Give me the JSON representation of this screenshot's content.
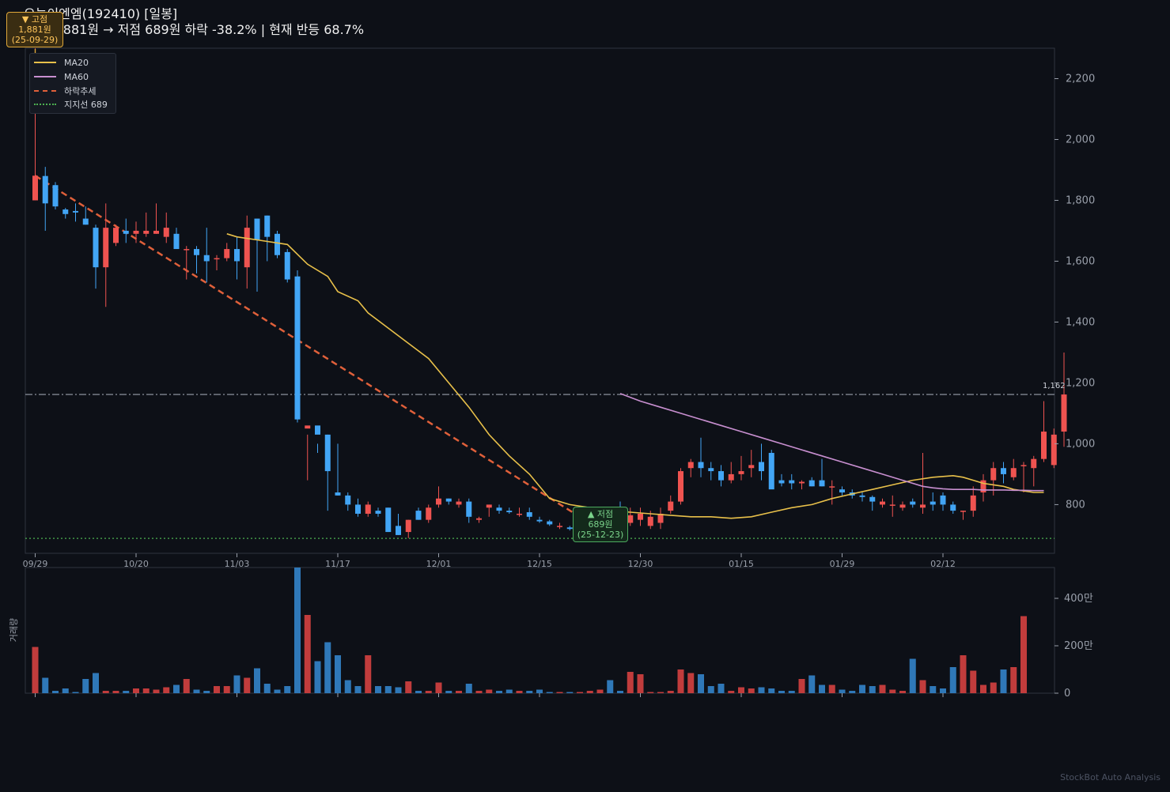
{
  "header": {
    "line1": "오늘이엔엠(192410)  [일봉]",
    "line2": "고점 1,881원 → 저점 689원  하락 -38.2%  |  현재 반등 68.7%"
  },
  "watermark": "StockBot Auto Analysis",
  "legend": {
    "items": [
      {
        "label": "MA20",
        "color": "#e8c04a",
        "style": "solid"
      },
      {
        "label": "MA60",
        "color": "#c88fd0",
        "style": "solid"
      },
      {
        "label": "하락추세",
        "color": "#e0603a",
        "style": "dashed"
      },
      {
        "label": "지지선 689",
        "color": "#4caf50",
        "style": "dotted"
      }
    ]
  },
  "callouts": {
    "high": {
      "marker": "▼ 고점",
      "price": "1,881원",
      "date": "(25-09-29)"
    },
    "low": {
      "marker": "▲ 저점",
      "price": "689원",
      "date": "(25-12-23)"
    }
  },
  "resistance_label": "1,162",
  "colors": {
    "up": "#ef5350",
    "down": "#42a5f5",
    "up_vol": "#c13c3c",
    "down_vol": "#2f78b8",
    "grid": "#222733",
    "axis": "#9aa0ab"
  },
  "chart_data": [
    {
      "type": "candlestick",
      "title": "오늘이엔엠(192410)  [일봉]",
      "x_tick_labels": [
        "09/29",
        "10/20",
        "11/03",
        "11/17",
        "12/01",
        "12/15",
        "12/30",
        "01/15",
        "01/29",
        "02/12"
      ],
      "x_tick_index": [
        0,
        10,
        20,
        30,
        40,
        50,
        60,
        70,
        80,
        90
      ],
      "y_ticks": [
        800,
        1000,
        1200,
        1400,
        1600,
        1800,
        2000,
        2200
      ],
      "y_tick_labels": [
        "800",
        "1,000",
        "1,200",
        "1,400",
        "1,600",
        "1,800",
        "2,000",
        "2,200"
      ],
      "ylim": [
        640,
        2300
      ],
      "support": 689,
      "resistance": 1162,
      "trend_line": {
        "from_index": 0,
        "from_value": 1881,
        "to_index": 54,
        "to_value": 760
      },
      "ohlc": [
        [
          1800,
          2300,
          1800,
          1881
        ],
        [
          1880,
          1910,
          1700,
          1790
        ],
        [
          1850,
          1860,
          1770,
          1780
        ],
        [
          1770,
          1775,
          1740,
          1755
        ],
        [
          1765,
          1790,
          1730,
          1760
        ],
        [
          1740,
          1780,
          1720,
          1720
        ],
        [
          1710,
          1720,
          1510,
          1580
        ],
        [
          1580,
          1790,
          1450,
          1710
        ],
        [
          1660,
          1720,
          1650,
          1710
        ],
        [
          1700,
          1740,
          1660,
          1690
        ],
        [
          1690,
          1730,
          1660,
          1700
        ],
        [
          1690,
          1760,
          1680,
          1700
        ],
        [
          1690,
          1790,
          1690,
          1700
        ],
        [
          1680,
          1760,
          1660,
          1710
        ],
        [
          1690,
          1710,
          1640,
          1640
        ],
        [
          1640,
          1650,
          1540,
          1640
        ],
        [
          1640,
          1650,
          1560,
          1620
        ],
        [
          1620,
          1710,
          1530,
          1600
        ],
        [
          1610,
          1620,
          1570,
          1610
        ],
        [
          1610,
          1660,
          1600,
          1640
        ],
        [
          1640,
          1680,
          1540,
          1600
        ],
        [
          1580,
          1750,
          1510,
          1710
        ],
        [
          1740,
          1740,
          1500,
          1670
        ],
        [
          1750,
          1750,
          1600,
          1680
        ],
        [
          1690,
          1700,
          1610,
          1620
        ],
        [
          1630,
          1640,
          1530,
          1540
        ],
        [
          1550,
          1570,
          1070,
          1080
        ],
        [
          1050,
          1030,
          880,
          1060
        ],
        [
          1060,
          1000,
          970,
          1030
        ],
        [
          1030,
          1030,
          780,
          910
        ],
        [
          840,
          1000,
          830,
          830
        ],
        [
          830,
          840,
          780,
          800
        ],
        [
          800,
          820,
          760,
          770
        ],
        [
          770,
          810,
          760,
          800
        ],
        [
          780,
          790,
          760,
          770
        ],
        [
          790,
          790,
          710,
          710
        ],
        [
          730,
          770,
          700,
          700
        ],
        [
          710,
          750,
          690,
          750
        ],
        [
          780,
          790,
          750,
          750
        ],
        [
          750,
          800,
          740,
          790
        ],
        [
          800,
          860,
          790,
          820
        ],
        [
          820,
          820,
          800,
          810
        ],
        [
          800,
          820,
          790,
          810
        ],
        [
          810,
          820,
          740,
          760
        ],
        [
          750,
          760,
          740,
          755
        ],
        [
          790,
          800,
          760,
          800
        ],
        [
          790,
          800,
          770,
          780
        ],
        [
          780,
          790,
          770,
          775
        ],
        [
          770,
          790,
          760,
          770
        ],
        [
          775,
          790,
          750,
          760
        ],
        [
          750,
          760,
          740,
          745
        ],
        [
          745,
          750,
          730,
          735
        ],
        [
          730,
          740,
          720,
          730
        ],
        [
          725,
          730,
          715,
          720
        ],
        [
          700,
          730,
          700,
          720
        ],
        [
          740,
          760,
          720,
          740
        ],
        [
          750,
          770,
          730,
          755
        ],
        [
          760,
          780,
          740,
          745
        ],
        [
          780,
          810,
          760,
          775
        ],
        [
          740,
          790,
          730,
          765
        ],
        [
          750,
          790,
          730,
          770
        ],
        [
          730,
          780,
          720,
          760
        ],
        [
          740,
          790,
          720,
          770
        ],
        [
          780,
          830,
          770,
          810
        ],
        [
          810,
          920,
          800,
          910
        ],
        [
          920,
          950,
          890,
          940
        ],
        [
          940,
          1020,
          890,
          920
        ],
        [
          920,
          940,
          880,
          910
        ],
        [
          910,
          930,
          860,
          880
        ],
        [
          880,
          940,
          870,
          900
        ],
        [
          900,
          960,
          880,
          910
        ],
        [
          920,
          980,
          890,
          930
        ],
        [
          940,
          1000,
          880,
          910
        ],
        [
          970,
          980,
          890,
          850
        ],
        [
          880,
          900,
          860,
          870
        ],
        [
          880,
          900,
          850,
          870
        ],
        [
          870,
          880,
          850,
          875
        ],
        [
          880,
          890,
          860,
          860
        ],
        [
          880,
          950,
          860,
          860
        ],
        [
          860,
          880,
          800,
          860
        ],
        [
          850,
          860,
          830,
          840
        ],
        [
          840,
          850,
          820,
          830
        ],
        [
          830,
          840,
          810,
          825
        ],
        [
          825,
          830,
          780,
          810
        ],
        [
          800,
          820,
          790,
          810
        ],
        [
          800,
          830,
          760,
          800
        ],
        [
          790,
          810,
          780,
          800
        ],
        [
          810,
          820,
          790,
          800
        ],
        [
          790,
          970,
          770,
          800
        ],
        [
          810,
          840,
          780,
          800
        ],
        [
          830,
          840,
          780,
          800
        ],
        [
          800,
          810,
          770,
          780
        ],
        [
          780,
          780,
          750,
          780
        ],
        [
          780,
          860,
          760,
          830
        ],
        [
          840,
          900,
          810,
          880
        ],
        [
          880,
          940,
          830,
          920
        ],
        [
          920,
          940,
          870,
          900
        ],
        [
          890,
          950,
          880,
          920
        ],
        [
          930,
          940,
          840,
          930
        ],
        [
          920,
          960,
          860,
          950
        ],
        [
          950,
          1140,
          940,
          1040
        ],
        [
          930,
          1050,
          920,
          1030
        ],
        [
          1040,
          1300,
          990,
          1162
        ]
      ],
      "ma20": [
        [
          19,
          1690
        ],
        [
          20,
          1680
        ],
        [
          22,
          1670
        ],
        [
          25,
          1655
        ],
        [
          27,
          1590
        ],
        [
          29,
          1550
        ],
        [
          30,
          1500
        ],
        [
          32,
          1470
        ],
        [
          33,
          1430
        ],
        [
          35,
          1380
        ],
        [
          37,
          1330
        ],
        [
          39,
          1280
        ],
        [
          41,
          1200
        ],
        [
          43,
          1120
        ],
        [
          45,
          1030
        ],
        [
          47,
          960
        ],
        [
          49,
          900
        ],
        [
          50,
          860
        ],
        [
          51,
          820
        ],
        [
          53,
          800
        ],
        [
          55,
          790
        ],
        [
          57,
          780
        ],
        [
          59,
          775
        ],
        [
          61,
          770
        ],
        [
          63,
          765
        ],
        [
          65,
          760
        ],
        [
          67,
          760
        ],
        [
          69,
          755
        ],
        [
          71,
          760
        ],
        [
          73,
          775
        ],
        [
          75,
          790
        ],
        [
          77,
          800
        ],
        [
          79,
          820
        ],
        [
          81,
          835
        ],
        [
          83,
          850
        ],
        [
          85,
          865
        ],
        [
          87,
          880
        ],
        [
          89,
          890
        ],
        [
          91,
          895
        ],
        [
          92,
          890
        ],
        [
          93,
          880
        ],
        [
          94,
          870
        ],
        [
          95,
          865
        ],
        [
          96,
          860
        ],
        [
          97,
          850
        ],
        [
          98,
          845
        ],
        [
          99,
          840
        ],
        [
          100,
          840
        ]
      ],
      "ma60": [
        [
          58,
          1165
        ],
        [
          60,
          1140
        ],
        [
          62,
          1120
        ],
        [
          64,
          1100
        ],
        [
          66,
          1080
        ],
        [
          68,
          1060
        ],
        [
          70,
          1040
        ],
        [
          72,
          1020
        ],
        [
          74,
          1000
        ],
        [
          76,
          980
        ],
        [
          78,
          960
        ],
        [
          80,
          940
        ],
        [
          82,
          920
        ],
        [
          84,
          900
        ],
        [
          86,
          880
        ],
        [
          88,
          860
        ],
        [
          89,
          855
        ],
        [
          90,
          852
        ],
        [
          91,
          850
        ],
        [
          92,
          850
        ],
        [
          93,
          850
        ],
        [
          94,
          848
        ],
        [
          95,
          848
        ],
        [
          96,
          848
        ],
        [
          97,
          847
        ],
        [
          98,
          847
        ],
        [
          99,
          846
        ],
        [
          100,
          846
        ]
      ],
      "volume_yticks": [
        0,
        200,
        400
      ],
      "volume_ytick_labels": [
        "0",
        "200만",
        "400만"
      ],
      "volume_ylabel": "거래량",
      "volume_ylim": [
        0,
        530
      ],
      "volume": [
        195,
        65,
        10,
        20,
        5,
        60,
        85,
        10,
        10,
        10,
        20,
        20,
        15,
        25,
        35,
        60,
        15,
        10,
        30,
        30,
        75,
        65,
        105,
        40,
        15,
        30,
        530,
        330,
        135,
        215,
        160,
        55,
        30,
        160,
        30,
        30,
        25,
        50,
        10,
        10,
        45,
        10,
        10,
        40,
        10,
        15,
        10,
        15,
        10,
        10,
        15,
        5,
        5,
        5,
        5,
        10,
        15,
        55,
        10,
        90,
        80,
        5,
        5,
        10,
        100,
        85,
        80,
        30,
        40,
        10,
        25,
        20,
        25,
        20,
        10,
        10,
        60,
        75,
        35,
        35,
        15,
        10,
        35,
        30,
        35,
        15,
        10,
        145,
        55,
        30,
        20,
        110,
        160,
        95,
        35,
        45,
        100,
        110,
        325
      ]
    }
  ]
}
